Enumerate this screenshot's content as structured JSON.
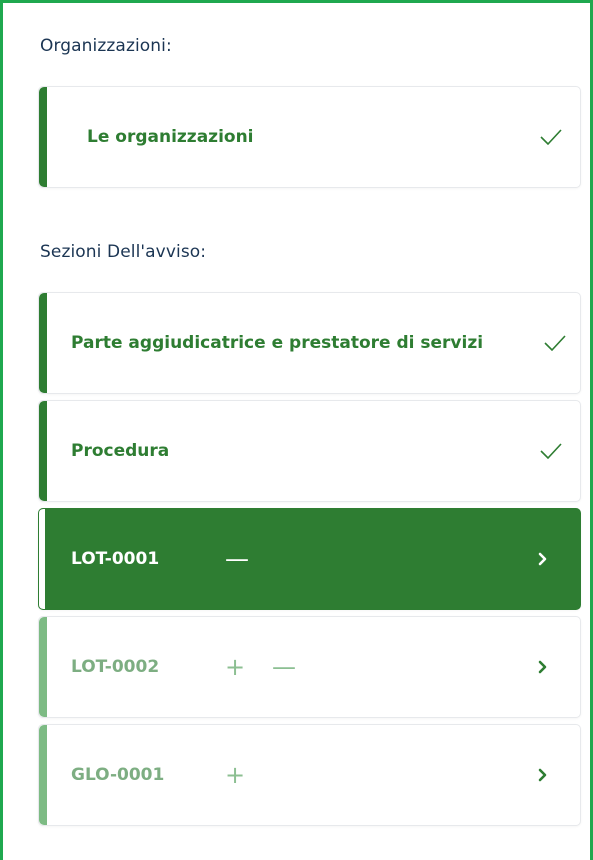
{
  "organizations": {
    "heading": "Organizzazioni:",
    "items": [
      {
        "label": "Le organizzazioni",
        "status_icon": "check-icon"
      }
    ]
  },
  "sections": {
    "heading": "Sezioni Dell'avviso:",
    "items": [
      {
        "label": "Parte aggiudicatrice e prestatore di servizi",
        "status_icon": "check-icon"
      },
      {
        "label": "Procedura",
        "status_icon": "check-icon"
      }
    ],
    "lots": [
      {
        "label": "LOT-0001",
        "controls": [
          "—"
        ],
        "state": "active"
      },
      {
        "label": "LOT-0002",
        "controls": [
          "+",
          "—"
        ],
        "state": "inactive"
      },
      {
        "label": "GLO-0001",
        "controls": [
          "+"
        ],
        "state": "inactive"
      }
    ]
  },
  "colors": {
    "frame_border": "#1fa84f",
    "accent_green": "#2e7d32",
    "light_green": "#7dbb84",
    "heading_text": "#1b3553"
  }
}
